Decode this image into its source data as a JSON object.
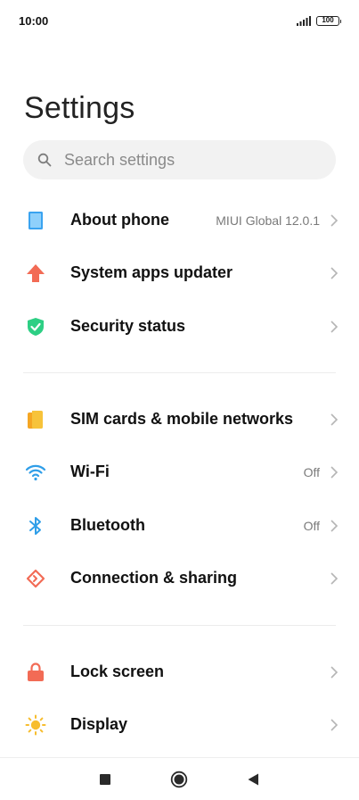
{
  "status_bar": {
    "time": "10:00",
    "battery": "100"
  },
  "page": {
    "title": "Settings"
  },
  "search": {
    "placeholder": "Search settings"
  },
  "rows": [
    {
      "label": "About phone",
      "value": "MIUI Global 12.0.1",
      "icon": "phone-icon",
      "color": "#3aa3f0"
    },
    {
      "label": "System apps updater",
      "value": "",
      "icon": "arrow-up-icon",
      "color": "#f26b55"
    },
    {
      "label": "Security status",
      "value": "",
      "icon": "shield-check-icon",
      "color": "#2dcf84"
    },
    {
      "label": "SIM cards & mobile networks",
      "value": "",
      "icon": "sim-card-icon",
      "color": "#f7bd2e"
    },
    {
      "label": "Wi-Fi",
      "value": "Off",
      "icon": "wifi-icon",
      "color": "#2f9ee8"
    },
    {
      "label": "Bluetooth",
      "value": "Off",
      "icon": "bluetooth-icon",
      "color": "#2f9ee8"
    },
    {
      "label": "Connection & sharing",
      "value": "",
      "icon": "share-icon",
      "color": "#f26b55"
    },
    {
      "label": "Lock screen",
      "value": "",
      "icon": "lock-icon",
      "color": "#f26b55"
    },
    {
      "label": "Display",
      "value": "",
      "icon": "sun-icon",
      "color": "#f7bd2e"
    }
  ],
  "nav": {
    "recents": "square-icon",
    "home": "circle-icon",
    "back": "triangle-back-icon"
  }
}
